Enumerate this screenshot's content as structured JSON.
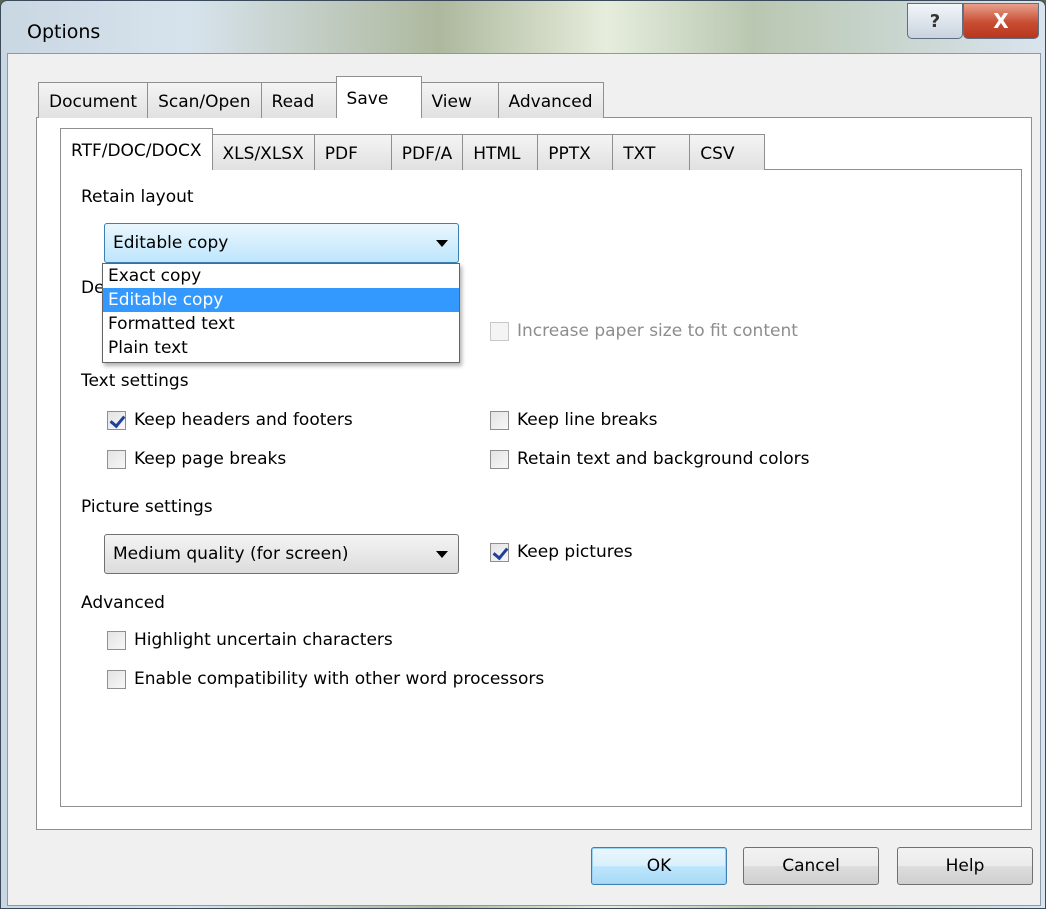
{
  "window": {
    "title": "Options",
    "help_glyph": "?",
    "close_glyph": "X"
  },
  "outer_tabs": [
    {
      "label": "Document"
    },
    {
      "label": "Scan/Open"
    },
    {
      "label": "Read"
    },
    {
      "label": "Save",
      "active": true
    },
    {
      "label": "View"
    },
    {
      "label": "Advanced"
    }
  ],
  "inner_tabs": [
    {
      "label": "RTF/DOC/DOCX",
      "active": true
    },
    {
      "label": "XLS/XLSX"
    },
    {
      "label": "PDF"
    },
    {
      "label": "PDF/A"
    },
    {
      "label": "HTML"
    },
    {
      "label": "PPTX"
    },
    {
      "label": "TXT"
    },
    {
      "label": "CSV"
    }
  ],
  "retain_layout": {
    "heading": "Retain layout",
    "selected": "Editable copy",
    "options": [
      "Exact copy",
      "Editable copy",
      "Formatted text",
      "Plain text"
    ],
    "hidden_heading_fragment": "De"
  },
  "paper": {
    "increase_paper_label": "Increase paper size to fit content"
  },
  "text_settings": {
    "heading": "Text settings",
    "keep_headers_footers": "Keep headers and footers",
    "keep_line_breaks": "Keep line breaks",
    "keep_page_breaks": "Keep page breaks",
    "retain_colors": "Retain text and background colors"
  },
  "picture_settings": {
    "heading": "Picture settings",
    "quality_selected": "Medium quality (for screen)",
    "keep_pictures": "Keep pictures"
  },
  "advanced": {
    "heading": "Advanced",
    "highlight_uncertain": "Highlight uncertain characters",
    "enable_compat": "Enable compatibility with other word processors"
  },
  "buttons": {
    "ok": "OK",
    "cancel": "Cancel",
    "help": "Help"
  }
}
